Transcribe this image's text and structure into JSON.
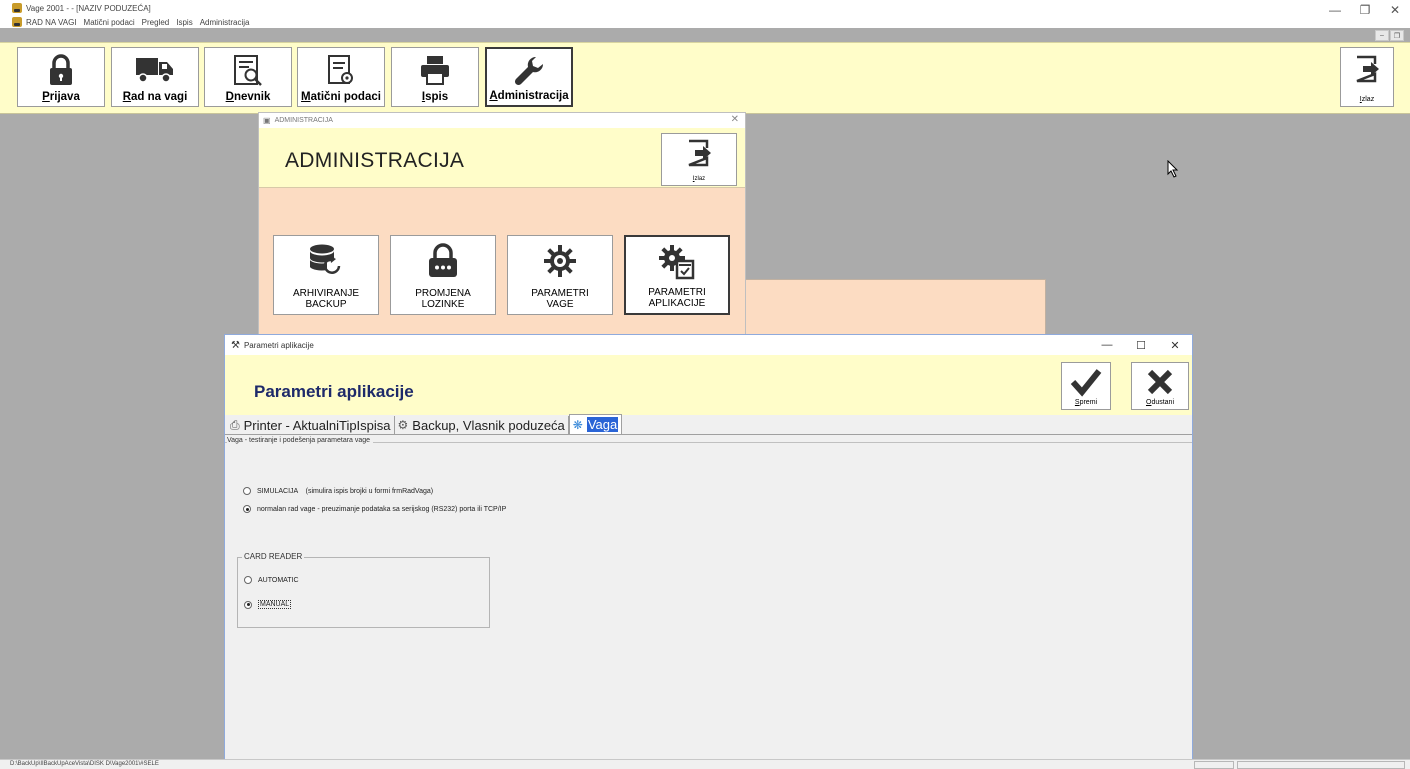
{
  "app": {
    "title": "Vage 2001 - - [NAZIV PODUZEĆA]",
    "menu": [
      "RAD NA VAGI",
      "Matični podaci",
      "Pregled",
      "Ispis",
      "Administracija"
    ],
    "status_path": "D:\\BackUp\\IIBackUpAceVista\\DISK D\\Vage2001\\#SELE"
  },
  "toolbar": {
    "buttons": [
      {
        "label_u": "P",
        "label_rest": "rijava",
        "icon": "lock-icon"
      },
      {
        "label_u": "R",
        "label_rest": "ad na vagi",
        "icon": "truck-icon"
      },
      {
        "label_u": "D",
        "label_rest": "nevnik",
        "icon": "journal-search-icon"
      },
      {
        "label_u": "M",
        "label_rest": "atični podaci",
        "icon": "document-gear-icon"
      },
      {
        "label_u": "I",
        "label_rest": "spis",
        "icon": "printer-icon"
      },
      {
        "label_u": "A",
        "label_rest": "dministracija",
        "icon": "wrench-icon"
      }
    ],
    "exit_u": "I",
    "exit_rest": "zlaz"
  },
  "admin": {
    "window_title": "ADMINISTRACIJA",
    "heading": "ADMINISTRACIJA",
    "exit_u": "I",
    "exit_rest": "zlaz",
    "tiles": [
      {
        "line1": "ARHIVIRANJE",
        "line2": "BACKUP",
        "icon": "database-backup-icon"
      },
      {
        "line1": "PROMJENA",
        "line2": "LOZINKE",
        "icon": "password-lock-icon"
      },
      {
        "line1": "PARAMETRI",
        "line2": "VAGE",
        "icon": "gear-icon"
      },
      {
        "line1": "PARAMETRI",
        "line2": "APLIKACIJE",
        "icon": "gears-checklist-icon"
      }
    ]
  },
  "params": {
    "window_title": "Parametri aplikacije",
    "heading": "Parametri aplikacije",
    "save_u": "S",
    "save_rest": "premi",
    "cancel_u": "O",
    "cancel_rest": "dustani",
    "tabs": [
      "Printer - AktualniTipIspisa",
      "Backup, Vlasnik poduzeća",
      "Vaga"
    ],
    "section_legend": "Vaga - testiranje i podešenja parametara vage",
    "mode_options": [
      {
        "label": "SIMULACIJA    (simulira ispis brojki u formi frmRadVaga)",
        "checked": false
      },
      {
        "label": "normalan rad vage - preuzimanje podataka sa serijskog (RS232) porta ili TCP/IP",
        "checked": true
      }
    ],
    "card_reader": {
      "legend": "CARD READER",
      "options": [
        {
          "label": "AUTOMATIC",
          "checked": false
        },
        {
          "label": "MANUAL",
          "checked": true
        }
      ]
    }
  }
}
